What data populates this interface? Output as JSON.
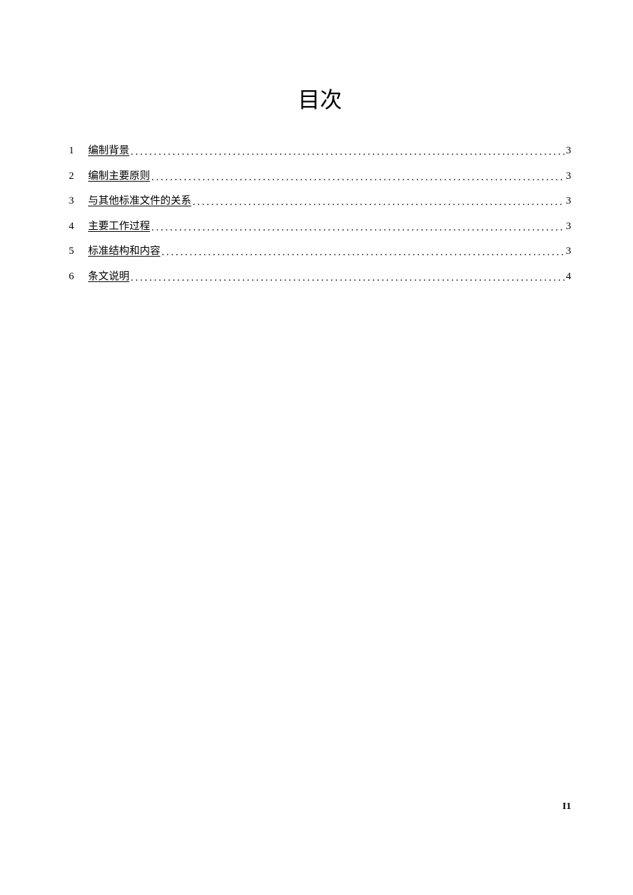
{
  "title": "目次",
  "toc": [
    {
      "num": "1",
      "label": "编制背景",
      "page": "3"
    },
    {
      "num": "2",
      "label": "编制主要原则",
      "page": "3"
    },
    {
      "num": "3",
      "label": "与其他标准文件的关系",
      "page": "3"
    },
    {
      "num": "4",
      "label": "主要工作过程",
      "page": "3"
    },
    {
      "num": "5",
      "label": "标准结构和内容",
      "page": "3"
    },
    {
      "num": "6",
      "label": "条文说明",
      "page": "4"
    }
  ],
  "page_number": "I1"
}
